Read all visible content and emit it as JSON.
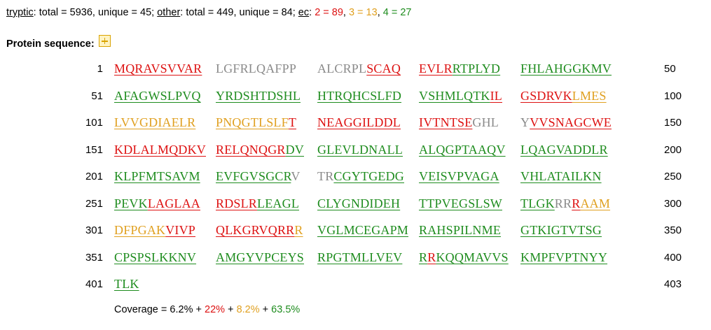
{
  "summary": {
    "tryptic_label": "tryptic",
    "tryptic_text": ": total = 5936, unique = 45; ",
    "other_label": "other",
    "other_text": ": total = 449, unique = 84; ",
    "ec_label": "ec",
    "ec_sep": ": ",
    "ec2": "2 = 89",
    "comma1": ", ",
    "ec3": "3 = 13",
    "comma2": ", ",
    "ec4": "4 = 27"
  },
  "header": {
    "title": "Protein sequence:"
  },
  "colors": {
    "red": "#dd1111",
    "orange": "#e0a020",
    "green": "#1e8c1e",
    "gray": "#8a8a8a"
  },
  "rows": [
    {
      "start": "1",
      "end": "50",
      "blocks": [
        [
          [
            "r",
            "MQRAVSVVAR"
          ]
        ],
        [
          [
            "n",
            "LGFRLQAFPP"
          ]
        ],
        [
          [
            "n",
            "ALCRPL"
          ],
          [
            "r",
            "SCAQ"
          ]
        ],
        [
          [
            "r",
            "EVLR"
          ],
          [
            "g",
            "RTPLYD"
          ]
        ],
        [
          [
            "g",
            "FHLAHGGKMV"
          ]
        ]
      ]
    },
    {
      "start": "51",
      "end": "100",
      "blocks": [
        [
          [
            "g",
            "AFAGWSLPVQ"
          ]
        ],
        [
          [
            "g",
            "YRDSHTDSHL"
          ]
        ],
        [
          [
            "g",
            "HTRQHCSLFD"
          ]
        ],
        [
          [
            "g",
            "VSHMLQTK"
          ],
          [
            "r",
            "IL"
          ]
        ],
        [
          [
            "r",
            "GSDRVK"
          ],
          [
            "o",
            "LMES"
          ]
        ]
      ]
    },
    {
      "start": "101",
      "end": "150",
      "blocks": [
        [
          [
            "o",
            "LVVGDIAELR"
          ]
        ],
        [
          [
            "o",
            "PNQGTLSLF"
          ],
          [
            "r",
            "T"
          ]
        ],
        [
          [
            "r",
            "NEAGGILDDL"
          ]
        ],
        [
          [
            "r",
            "IVTNTSE"
          ],
          [
            "n",
            "GHL"
          ]
        ],
        [
          [
            "n",
            "Y"
          ],
          [
            "r",
            "VVSNAGCWE"
          ]
        ]
      ]
    },
    {
      "start": "151",
      "end": "200",
      "blocks": [
        [
          [
            "r",
            "KDLALMQDKV"
          ]
        ],
        [
          [
            "r",
            "RELQNQGR"
          ],
          [
            "g",
            "DV"
          ]
        ],
        [
          [
            "g",
            "GLEVLDNALL"
          ]
        ],
        [
          [
            "g",
            "ALQGPTAAQV"
          ]
        ],
        [
          [
            "g",
            "LQAGVADDLR"
          ]
        ]
      ]
    },
    {
      "start": "201",
      "end": "250",
      "blocks": [
        [
          [
            "g",
            "KLPFMTSAVM"
          ]
        ],
        [
          [
            "g",
            "EVFGVSGCR"
          ],
          [
            "n",
            "V"
          ]
        ],
        [
          [
            "n",
            "TR"
          ],
          [
            "g",
            "CGYTGEDG"
          ]
        ],
        [
          [
            "g",
            "VEISVPVAGA"
          ]
        ],
        [
          [
            "g",
            "VHLATAILKN"
          ]
        ]
      ]
    },
    {
      "start": "251",
      "end": "300",
      "blocks": [
        [
          [
            "g",
            "PEVK"
          ],
          [
            "r",
            "LAGLAA"
          ]
        ],
        [
          [
            "r",
            "RDSLR"
          ],
          [
            "g",
            "LEAGL"
          ]
        ],
        [
          [
            "g",
            "CLYGNDIDEH"
          ]
        ],
        [
          [
            "g",
            "TTPVEGSLSW"
          ]
        ],
        [
          [
            "g",
            "TLGK"
          ],
          [
            "n",
            "RR"
          ],
          [
            "r",
            "R"
          ],
          [
            "o",
            "AAM"
          ]
        ]
      ]
    },
    {
      "start": "301",
      "end": "350",
      "blocks": [
        [
          [
            "o",
            "DFPGAK"
          ],
          [
            "r",
            "VIVP"
          ]
        ],
        [
          [
            "r",
            "QLKGRVQRR"
          ],
          [
            "o",
            "R"
          ]
        ],
        [
          [
            "g",
            "VGLMCEGAPM"
          ]
        ],
        [
          [
            "g",
            "RAHSPILNME"
          ]
        ],
        [
          [
            "g",
            "GTKIGTVTSG"
          ]
        ]
      ]
    },
    {
      "start": "351",
      "end": "400",
      "blocks": [
        [
          [
            "g",
            "CPSPSLKKNV"
          ]
        ],
        [
          [
            "g",
            "AMGYVPCEYS"
          ]
        ],
        [
          [
            "g",
            "RPGTMLLVEV"
          ]
        ],
        [
          [
            "g",
            "R"
          ],
          [
            "r",
            "R"
          ],
          [
            "g",
            "KQQMAVVS"
          ]
        ],
        [
          [
            "g",
            "KMPFVPTNYY"
          ]
        ]
      ]
    },
    {
      "start": "401",
      "end": "403",
      "blocks": [
        [
          [
            "g",
            "TLK"
          ]
        ]
      ]
    }
  ],
  "coverage": {
    "label": "Coverage = ",
    "v1": "6.2%",
    "plus1": " + ",
    "v2": "22%",
    "plus2": " + ",
    "v3": "8.2%",
    "plus3": " + ",
    "v4": "63.5%"
  }
}
